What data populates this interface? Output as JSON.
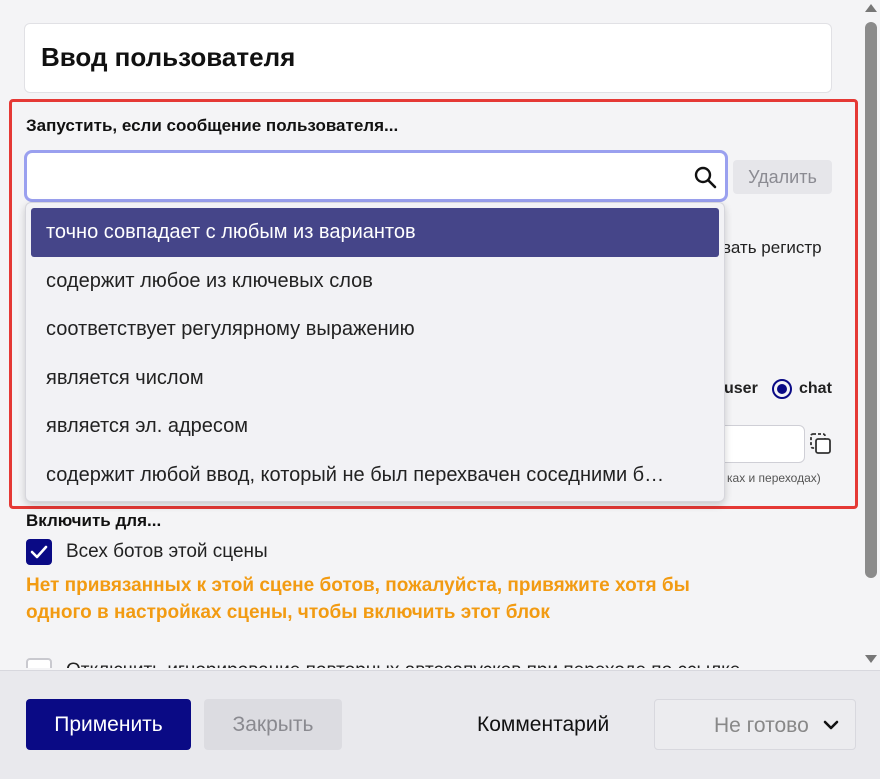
{
  "block": {
    "title": "Ввод пользователя"
  },
  "trigger": {
    "label": "Запустить, если сообщение пользователя...",
    "search_value": "",
    "delete_label": "Удалить",
    "options": [
      "точно совпадает с любым из вариантов",
      "содержит любое из ключевых слов",
      "соответствует регулярному выражению",
      "является числом",
      "является эл. адресом",
      "содержит любой ввод, который не был перехвачен соседними б…"
    ],
    "selected_option_index": 0
  },
  "background": {
    "case_text": "вать регистр",
    "radio_user_label": "user",
    "radio_chat_label": "chat",
    "hint_text": "ках и переходах)"
  },
  "enable": {
    "label": "Включить для...",
    "all_bots_label": "Всех ботов этой сцены",
    "all_bots_checked": true,
    "warning": "Нет привязанных к этой сцене ботов, пожалуйста, привяжите хотя бы одного в настройках сцены, чтобы включить этот блок",
    "second_option_label": "Отключить игнорирование повторных автозапусков при переходе по ссылке"
  },
  "footer": {
    "apply_label": "Применить",
    "close_label": "Закрыть",
    "comment_label": "Комментарий",
    "status_label": "Не готово"
  },
  "colors": {
    "primary": "#0a0a85",
    "highlight_frame": "#e53935",
    "selected_option": "#454589",
    "warning": "#f29b12"
  }
}
